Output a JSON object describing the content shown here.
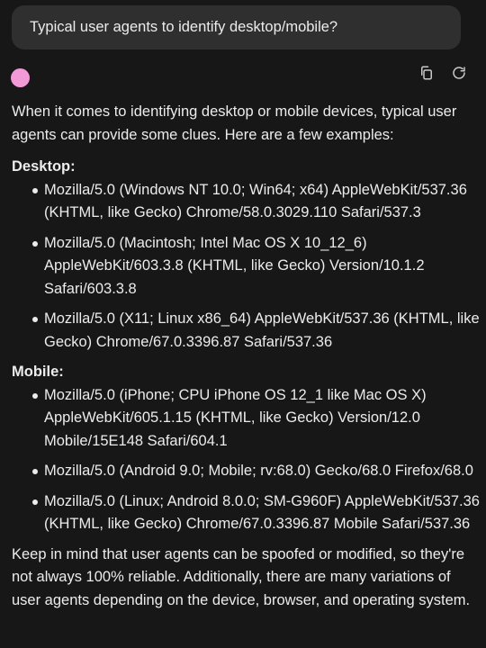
{
  "user_message": {
    "text": "Typical user agents to identify desktop/mobile?"
  },
  "assistant": {
    "avatar_color": "#f29ad8",
    "actions": [
      {
        "name": "copy-icon"
      },
      {
        "name": "regenerate-icon"
      }
    ],
    "intro": "When it comes to identifying desktop or mobile devices, typical user agents can provide some clues. Here are a few examples:",
    "desktop": {
      "heading": "Desktop:",
      "items": [
        "Mozilla/5.0 (Windows NT 10.0; Win64; x64) AppleWebKit/537.36 (KHTML, like Gecko) Chrome/58.0.3029.110 Safari/537.3",
        "Mozilla/5.0 (Macintosh; Intel Mac OS X 10_12_6) AppleWebKit/603.3.8 (KHTML, like Gecko) Version/10.1.2 Safari/603.3.8",
        "Mozilla/5.0 (X11; Linux x86_64) AppleWebKit/537.36 (KHTML, like Gecko) Chrome/67.0.3396.87 Safari/537.36"
      ]
    },
    "mobile": {
      "heading": "Mobile:",
      "items": [
        "Mozilla/5.0 (iPhone; CPU iPhone OS 12_1 like Mac OS X) AppleWebKit/605.1.15 (KHTML, like Gecko) Version/12.0 Mobile/15E148 Safari/604.1",
        "Mozilla/5.0 (Android 9.0; Mobile; rv:68.0) Gecko/68.0 Firefox/68.0",
        "Mozilla/5.0 (Linux; Android 8.0.0; SM-G960F) AppleWebKit/537.36 (KHTML, like Gecko) Chrome/67.0.3396.87 Mobile Safari/537.36"
      ]
    },
    "outro": "Keep in mind that user agents can be spoofed or modified, so they're not always 100% reliable. Additionally, there are many variations of user agents depending on the device, browser, and operating system."
  }
}
